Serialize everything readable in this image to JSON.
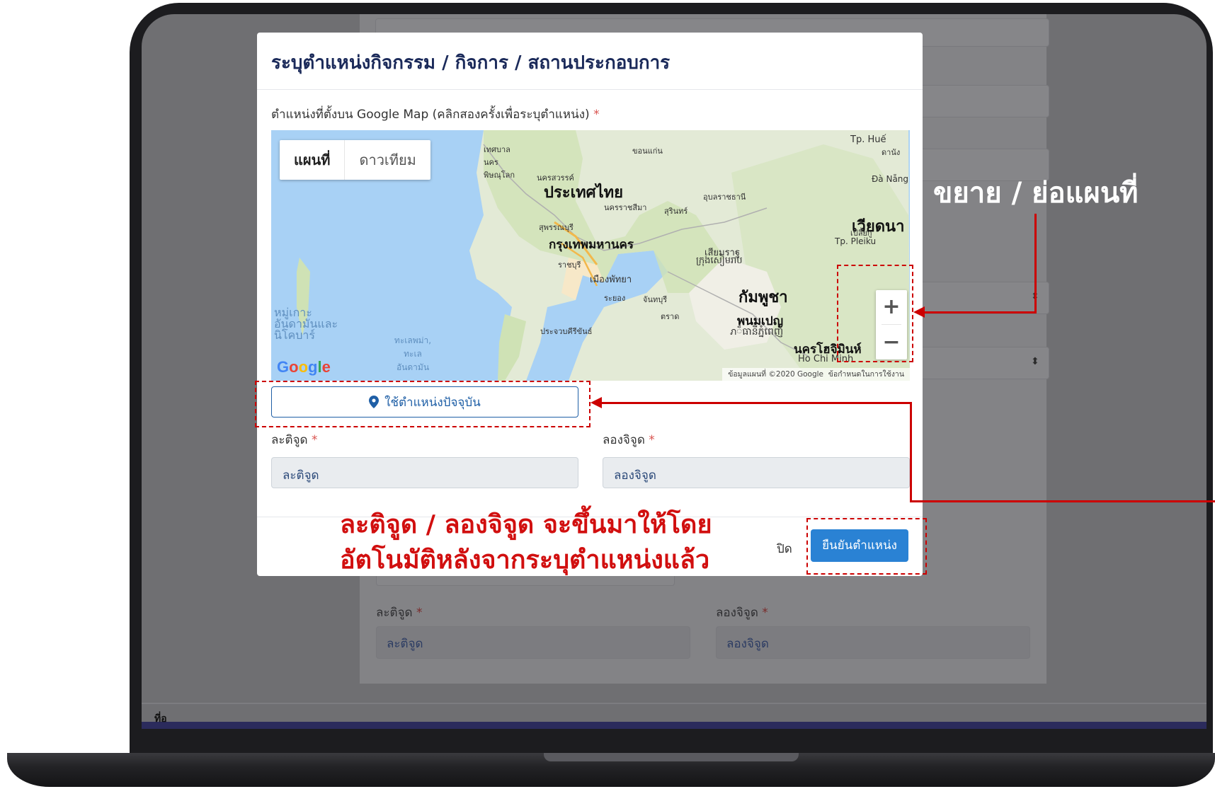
{
  "background_form": {
    "latitude_label": "ละติจูด",
    "longitude_label": "ลองจิจูด",
    "latitude_placeholder": "ละติจูด",
    "longitude_placeholder": "ลองจิจูด",
    "partial_text": "ที่อ"
  },
  "modal": {
    "title": "ระบุตำแหน่งกิจกรรม / กิจการ / สถานประกอบการ",
    "map_label": "ตำแหน่งที่ตั้งบน Google Map (คลิกสองครั้งเพื่อระบุตำแหน่ง)",
    "required_mark": "*",
    "map": {
      "type_buttons": [
        "แผนที่",
        "ดาวเทียม"
      ],
      "labels": {
        "thailand": "ประเทศไทย",
        "bangkok": "กรุงเทพมหานคร",
        "vietnam": "เวียดนา",
        "cambodia": "กัมพูชา",
        "phnom_penh": "พนมเปญ",
        "phnom_penh_km": "ภ៏ធានីភ្នំពេញ",
        "hcm": "นครโฮจิมินห์",
        "hcm_en": "Ho Chi Minh",
        "pattaya": "เมืองพัทยา",
        "siem_reap": "เสียมราฐ",
        "siem_reap_km": "ក្រុងសៀមរាប",
        "hue": "Tp. Huế",
        "danang_th": "ดานัง",
        "danang": "Đà Nẵng",
        "pleiku_th": "เปลี้ยกู",
        "pleiku": "Tp. Pleiku",
        "phitsanulok": "เทศบาลนคร พิษณุโลก",
        "khonkaen": "ขอนแก่น",
        "nakhonsawan": "นครสวรรค์",
        "nakhonratchasima": "นครราชสีมา",
        "surin": "สุรินทร์",
        "ubon": "อุบลราชธานี",
        "suphanburi": "สุพรรณบุรี",
        "ratchaburi": "ราชบุรี",
        "rayong": "ระยอง",
        "chanthaburi": "จันทบุรี",
        "trat": "ตราด",
        "prachuap": "ประจวบคีรีขันธ์",
        "andaman_islands": "หมู่เกาะอันดามันและนิโคบาร์",
        "andaman_sea": "ทะเลพม่า, ทะเล อันดามัน"
      },
      "attribution": "ข้อมูลแผนที่ ©2020 Google",
      "terms": "ข้อกำหนดในการใช้งาน",
      "zoom_in": "+",
      "zoom_out": "−"
    },
    "use_location_button": "ใช้ตำแหน่งปัจจุบัน",
    "latitude_label": "ละติจูด",
    "longitude_label": "ลองจิจูด",
    "latitude_placeholder": "ละติจูด",
    "longitude_placeholder": "ลองจิจูด",
    "close_button": "ปิด",
    "confirm_button": "ยืนยันตำแหน่ง"
  },
  "annotations": {
    "zoom": "ขยาย / ย่อแผนที่",
    "auto_fill_line1": "ละติจูด / ลองจิจูด จะขึ้นมาให้โดย",
    "auto_fill_line2": "อัตโนมัติหลังจากระบุตำแหน่งแล้ว"
  },
  "colors": {
    "annotation_red": "#cc0000",
    "primary_blue": "#2a82d4",
    "title_navy": "#1b2a5a"
  }
}
